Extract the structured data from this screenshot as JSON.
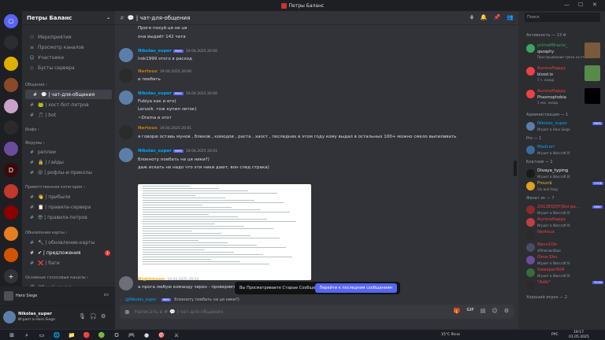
{
  "window": {
    "title": "Петры Баланс",
    "controls": [
      "—",
      "☐",
      "✕"
    ]
  },
  "servers": [
    {
      "label": "⎔",
      "color": "#5865f2"
    },
    {
      "label": "",
      "color": "#2b2d31"
    },
    {
      "label": "",
      "color": "#e0b000"
    },
    {
      "label": "",
      "color": "#8a4a2a"
    },
    {
      "label": "",
      "color": "#c8a2c8"
    },
    {
      "label": "",
      "color": "#2a2a2a"
    },
    {
      "label": "",
      "color": "#6a4c9c"
    },
    {
      "label": "D",
      "color": "#3a0a0a"
    },
    {
      "label": "",
      "color": "#c0392b"
    },
    {
      "label": "",
      "color": "#8b0000"
    },
    {
      "label": "",
      "color": "#e67e22"
    },
    {
      "label": "",
      "color": "#d35400"
    },
    {
      "label": "+",
      "color": "#313338"
    },
    {
      "label": "⊙",
      "color": "#313338"
    }
  ],
  "guild": {
    "name": "Петры Баланс"
  },
  "channels": [
    {
      "icon": "⚇",
      "label": "Мероприятия",
      "kind": "row"
    },
    {
      "icon": "≡",
      "label": "Просмотр каналов",
      "kind": "row"
    },
    {
      "icon": "☺",
      "label": "Участники",
      "kind": "row"
    },
    {
      "icon": "◇",
      "label": "Бусты сервера",
      "kind": "row"
    },
    {
      "icon": "",
      "label": "Общение ›",
      "kind": "cat"
    },
    {
      "icon": "#",
      "label": "💬 | чат-для-общения",
      "kind": "active"
    },
    {
      "icon": "#",
      "label": "🐸 | хост-бот-петров",
      "kind": "row"
    },
    {
      "icon": "#",
      "label": "🎵 | bot",
      "kind": "row"
    },
    {
      "icon": "",
      "label": "Инфо ›",
      "kind": "cat"
    },
    {
      "icon": "",
      "label": "Форумы ›",
      "kind": "cat"
    },
    {
      "icon": "#",
      "label": "реплеи",
      "kind": "row"
    },
    {
      "icon": "#",
      "label": "🔒 | гайды",
      "kind": "row"
    },
    {
      "icon": "#",
      "label": "😡 | рофлы-и-приколы",
      "kind": "row"
    },
    {
      "icon": "",
      "label": "Приветственная категория ›",
      "kind": "cat"
    },
    {
      "icon": "#",
      "label": "👋 | прибыли",
      "kind": "row"
    },
    {
      "icon": "#",
      "label": "📋 | правила-сервера",
      "kind": "row"
    },
    {
      "icon": "#",
      "label": "😎 | правила-петров",
      "kind": "row"
    },
    {
      "icon": "",
      "label": "Обновления карты ›",
      "kind": "cat"
    },
    {
      "icon": "#",
      "label": "🔨 | обновление-карты",
      "kind": "row"
    },
    {
      "icon": "#",
      "label": "✔ | предложения",
      "kind": "unread",
      "badge": "2"
    },
    {
      "icon": "#",
      "label": "❌ | баги",
      "kind": "row"
    },
    {
      "icon": "",
      "label": "Основные голосовые каналы ›",
      "kind": "cat"
    },
    {
      "icon": "🔊",
      "label": "Общий канал",
      "kind": "row"
    }
  ],
  "voice": {
    "activity": "Hero Siege"
  },
  "user": {
    "name": "Nikolas_super",
    "status": "Играет в Hero Siege"
  },
  "header": {
    "channel": "💬 | чат-для-общения",
    "icons": [
      "⋕",
      "🔔",
      "📌",
      "👥"
    ]
  },
  "messages": [
    {
      "kind": "text",
      "text": "Проге похуй ця не ця"
    },
    {
      "kind": "text",
      "text": "она выдаёт 142 чата"
    },
    {
      "kind": "hdr",
      "name": "Nikolas_super",
      "color": "#00a8fc",
      "tag": "PBPE",
      "time": "19.04.2025 20:00",
      "av": "#5b7fa8"
    },
    {
      "kind": "text",
      "text": "lrok1999 этого в расход"
    },
    {
      "kind": "hdr",
      "name": "Nertoux",
      "color": "#c27c0e",
      "tag": "",
      "time": "19.04.2025 20:00",
      "av": "#2b2b2b"
    },
    {
      "kind": "text",
      "text": "и поебать"
    },
    {
      "kind": "hdr",
      "name": "Nikolas_super",
      "color": "#00a8fc",
      "tag": "PBPE",
      "time": "19.04.2025 20:00",
      "av": "#5b7fa8"
    },
    {
      "kind": "text",
      "text": "Fubiya как и его)"
    },
    {
      "kind": "text",
      "text": "Lerusik. тож купил леток)"
    },
    {
      "kind": "text",
      "text": "~Drama в этот"
    },
    {
      "kind": "hdr",
      "name": "Nertoux",
      "color": "#c27c0e",
      "tag": "",
      "time": "19.04.2025 20:01",
      "av": "#2b2b2b"
    },
    {
      "kind": "text",
      "text": "я говорю оставь мунов , блеков , комодов , раста , хаост , последних в этом году кому выдал в остальных 100+ можно смело выпиливать"
    },
    {
      "kind": "hdr",
      "name": "Nikolas_super",
      "color": "#00a8fc",
      "tag": "PBPE",
      "time": "19.04.2025 20:01",
      "av": "#5b7fa8"
    },
    {
      "kind": "text",
      "text": "блокноту поебать на ця ники?)"
    },
    {
      "kind": "text",
      "text": "даж искать не надо что эти ники дают, вон след страка)"
    },
    {
      "kind": "hdr",
      "name": "Nightmoon",
      "color": "#f0b232",
      "tag": "",
      "time": "19.04.2025 20:02",
      "av": "#6d6f78"
    },
    {
      "kind": "text",
      "text": "а прога любую команду через - проверяет?"
    }
  ],
  "banner": {
    "text": "Вы Просматриваете Старые Сообщения",
    "button": "Перейти к последним сообщениям"
  },
  "reply": {
    "prefix": "@Nikolas_super",
    "tag": "PBPE",
    "text": "блокноту поебать на ця ники?)"
  },
  "composer": {
    "placeholder": "Написать в # 💬 | чат-для-общения",
    "icons": [
      "🎁",
      "GIF",
      "▤",
      "☺",
      "⚙"
    ]
  },
  "members": {
    "search_placeholder": "Поиск",
    "activity_title": "Активность — 13 ⚙",
    "activities": [
      {
        "name": "primeMiracle_",
        "status": "qazaphy",
        "sub": "Прослушивание трека на этой...",
        "color": "#3ba55d",
        "thumb": "#7a5a3a"
      },
      {
        "name": "AuroraHappy",
        "status": "blood.io",
        "sub": "7 ч. назад",
        "color": "#ed4245",
        "thumb": "#5a8a4a"
      },
      {
        "name": "AuroraHappy",
        "status": "Phasmophobia",
        "sub": "1 нес. назад",
        "color": "#ed4245",
        "thumb": "#000000"
      }
    ],
    "groups": [
      {
        "title": "Администрация — 1",
        "items": [
          {
            "name": "Nikolas_super",
            "status": "Играет в Hero Siege",
            "color": "#00a8fc",
            "av": "#5b7fa8",
            "tag": "PBPE"
          }
        ]
      },
      {
        "title": "Pro — 1",
        "items": [
          {
            "name": "Madcorl",
            "status": "Играет в Warcraft III",
            "color": "#00a8fc",
            "av": "#3a6a9a",
            "tag": ""
          }
        ]
      },
      {
        "title": "Блатной — 2",
        "items": [
          {
            "name": "Divaya_typing",
            "status": "Играет в Warcraft III",
            "color": "#f2f3f5",
            "av": "#1a1a1a",
            "tag": ""
          },
          {
            "name": "Froun$",
            "status": "Vin and Yang",
            "color": "#f0b232",
            "av": "#e0a020",
            "tag": "CODE"
          }
        ]
      },
      {
        "title": "Фанат хк — 7",
        "items": [
          {
            "name": "2012ЕQQY(Богда...",
            "status": "Играет в Warcraft III",
            "color": "#ed4245",
            "av": "#8a2a2a",
            "tag": "UWU"
          },
          {
            "name": "AuroraHappy",
            "status": "Играет в Warcraft III",
            "color": "#ed4245",
            "av": "#c04040",
            "tag": ""
          },
          {
            "name": "Nertoux",
            "status": "",
            "color": "#ed4245",
            "av": "#2b2b2b",
            "tag": ""
          },
          {
            "name": "Nevv1Ok",
            "status": "#RheinlanBlue",
            "color": "#ed4245",
            "av": "#4a4a6a",
            "tag": ""
          },
          {
            "name": "Oma-Shu",
            "status": "Играет в Warcraft III",
            "color": "#ed4245",
            "av": "#6a4c9c",
            "tag": ""
          },
          {
            "name": "Sweeper904",
            "status": "Играет в Warcraft III",
            "color": "#ed4245",
            "av": "#3a6a3a",
            "tag": ""
          },
          {
            "name": "\"Adik\"",
            "status": "",
            "color": "#ed4245",
            "av": "#2a2a2a",
            "tag": "TCOM"
          }
        ]
      },
      {
        "title": "Хороший игрок — 2",
        "items": []
      }
    ]
  },
  "taskbar": {
    "weather": "15°C  Ясно",
    "lang": "РУС",
    "time": "19:17",
    "date": "01.05.2025",
    "apps": [
      "⊞",
      "⌕",
      "▭",
      "🌐",
      "📁",
      "🔴",
      "🟢",
      "O",
      "🎮",
      "●",
      "🎯",
      "⚔"
    ]
  }
}
